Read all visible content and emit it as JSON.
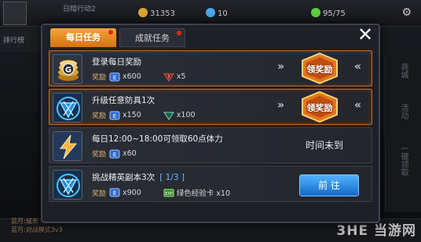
{
  "hud": {
    "player_name": "日暗行动2",
    "gold": "31353",
    "diamonds": "10",
    "stamina": "95/75",
    "left_label": "排行榜"
  },
  "side_menu": [
    "商城",
    "活动",
    "一键领取"
  ],
  "bottom_text": {
    "line1": "蓝月:城市",
    "line2": "蓝月:对战模式3v3"
  },
  "tabs": [
    {
      "label": "每日任务",
      "active": true
    },
    {
      "label": "成就任务",
      "active": false
    }
  ],
  "close_label": "✕",
  "tasks": [
    {
      "title": "登录每日奖励",
      "icon": "gold-coins-icon",
      "reward_label": "奖励",
      "rewards": [
        {
          "icon": "exp-badge-icon",
          "amount": "x600"
        },
        {
          "icon": "red-question-gem-icon",
          "amount": "x5"
        }
      ],
      "state": "claim",
      "claim_label": "领奖励"
    },
    {
      "title": "升级任意防具1次",
      "icon": "blue-emblem-icon",
      "reward_label": "奖励",
      "rewards": [
        {
          "icon": "exp-badge-icon",
          "amount": "x150"
        },
        {
          "icon": "green-gem-icon",
          "amount": "x100"
        }
      ],
      "state": "claim",
      "claim_label": "领奖励"
    },
    {
      "title": "每日12:00~18:00可领取60点体力",
      "icon": "lightning-icon",
      "reward_label": "奖励",
      "rewards": [
        {
          "icon": "exp-badge-icon",
          "amount": "x60"
        }
      ],
      "state": "not_yet",
      "status_label": "时间未到"
    },
    {
      "title": "挑战精英副本3次",
      "progress": "[ 1/3 ]",
      "icon": "blue-emblem-icon",
      "reward_label": "奖励",
      "rewards": [
        {
          "icon": "exp-badge-icon",
          "amount": "x900"
        },
        {
          "icon": "green-exp-card-icon",
          "amount": "绿色经验卡 x10"
        }
      ],
      "state": "go",
      "go_label": "前 往"
    }
  ],
  "watermark": "3HE 当游网",
  "colors": {
    "tab_active": "#e8891f",
    "highlight_border": "#c26a22",
    "go_button": "#2a86e0"
  }
}
